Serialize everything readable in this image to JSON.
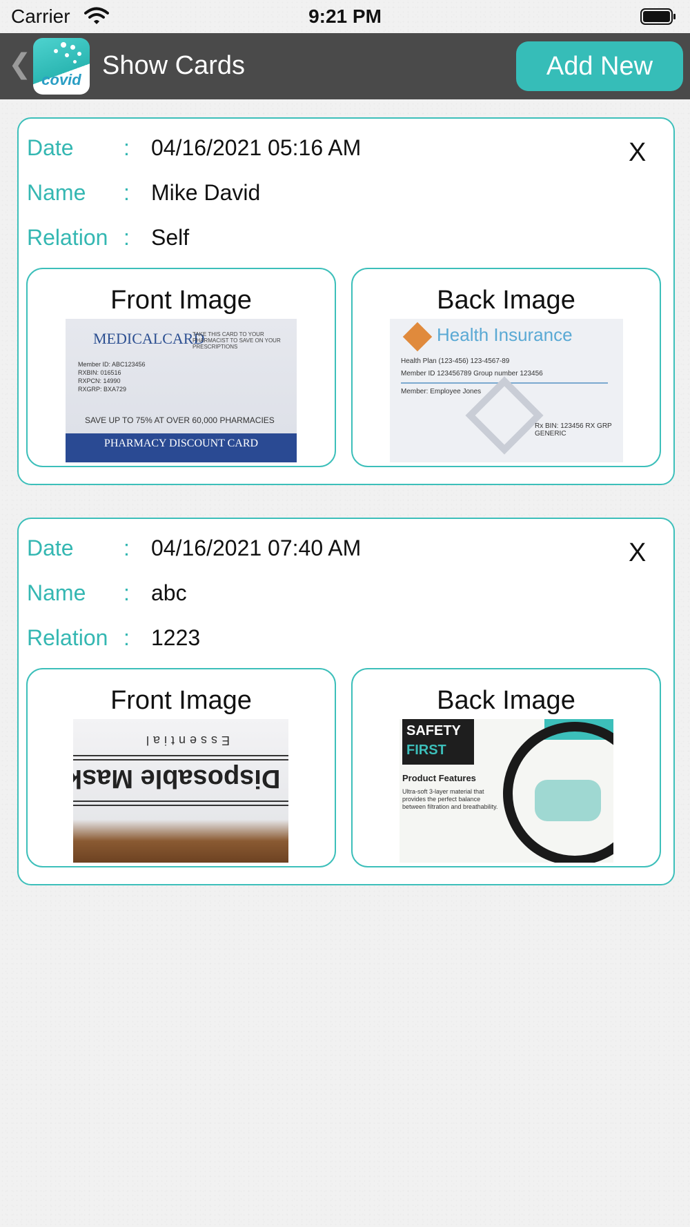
{
  "status_bar": {
    "carrier": "Carrier",
    "time": "9:21 PM"
  },
  "nav": {
    "title": "Show Cards",
    "add_button": "Add New",
    "back_glyph": "❮",
    "logo_text": "covid"
  },
  "labels": {
    "date": "Date",
    "name": "Name",
    "relation": "Relation",
    "colon": ":",
    "front": "Front Image",
    "back": "Back Image",
    "close": "X"
  },
  "cards": [
    {
      "date": "04/16/2021 05:16 AM",
      "name": "Mike David",
      "relation": "Self",
      "front_photo": {
        "title": "MEDICALCARD",
        "subtitle": "TAKE THIS CARD TO YOUR PHARMACIST TO SAVE ON YOUR PRESCRIPTIONS",
        "lines": [
          "Member ID: ABC123456",
          "RXBIN: 016516",
          "RXPCN: 14990",
          "RXGRP: BXA729"
        ],
        "save": "SAVE UP TO 75% AT OVER 60,000 PHARMACIES",
        "footer": "PHARMACY DISCOUNT CARD"
      },
      "back_photo": {
        "title": "Health Insurance",
        "lines": [
          "Health Plan (123-456) 123-4567-89",
          "Member ID 123456789   Group number 123456",
          "Member: Employee Jones",
          "Rx BIN: 123456  RX GRP GENERIC"
        ]
      }
    },
    {
      "date": "04/16/2021 07:40 AM",
      "name": "abc",
      "relation": "1223",
      "front_photo": {
        "text": "Disposable Mask",
        "small": "Essential"
      },
      "back_photo": {
        "badge": [
          "SAFETY",
          "FIRST"
        ],
        "heading": "Product Features",
        "body": "Ultra-soft 3-layer material that provides the perfect balance between filtration and breathability."
      }
    }
  ]
}
